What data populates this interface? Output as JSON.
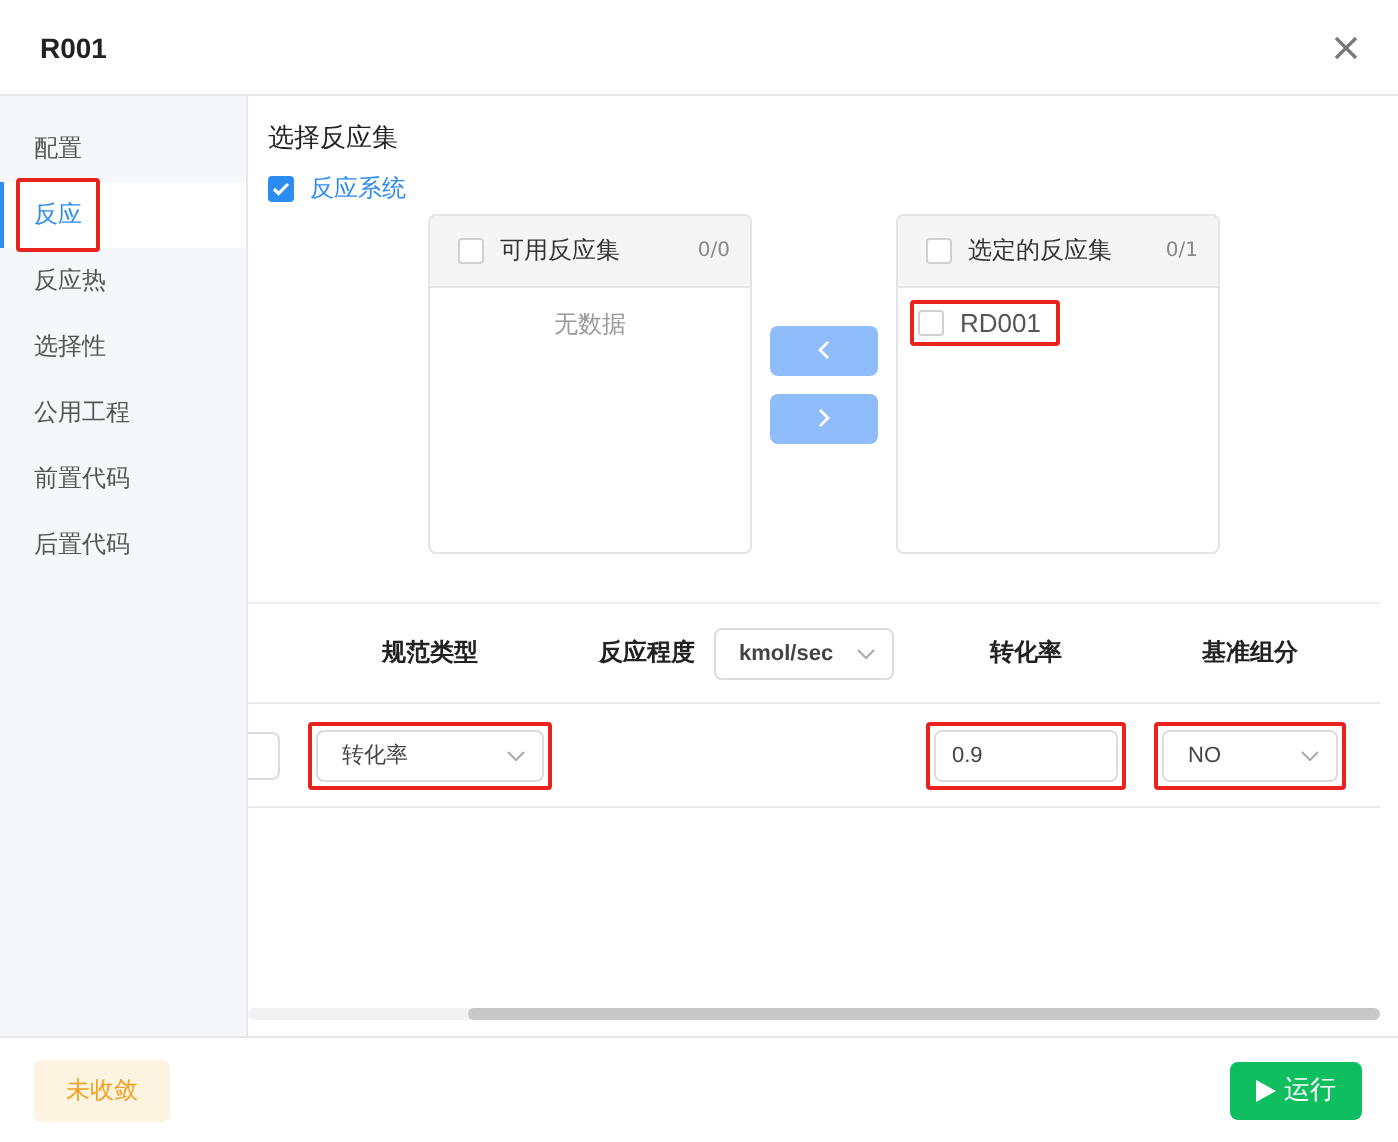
{
  "window": {
    "title": "R001"
  },
  "sidebar": {
    "items": [
      {
        "label": "配置",
        "selected": false,
        "highlighted": false
      },
      {
        "label": "反应",
        "selected": true,
        "highlighted": true
      },
      {
        "label": "反应热",
        "selected": false,
        "highlighted": false
      },
      {
        "label": "选择性",
        "selected": false,
        "highlighted": false
      },
      {
        "label": "公用工程",
        "selected": false,
        "highlighted": false
      },
      {
        "label": "前置代码",
        "selected": false,
        "highlighted": false
      },
      {
        "label": "后置代码",
        "selected": false,
        "highlighted": false
      }
    ]
  },
  "section_title": "选择反应集",
  "system_checkbox": {
    "label": "反应系统",
    "checked": true
  },
  "transfer": {
    "left": {
      "title": "可用反应集",
      "count": "0/0",
      "checked": false,
      "empty_text": "无数据"
    },
    "right": {
      "title": "选定的反应集",
      "count": "0/1",
      "checked": false,
      "items": [
        {
          "label": "RD001",
          "checked": false,
          "highlighted": true
        }
      ]
    }
  },
  "table": {
    "columns": [
      {
        "label": "规范类型"
      },
      {
        "label": "反应程度",
        "unit_select": "kmol/sec"
      },
      {
        "label": "转化率"
      },
      {
        "label": "基准组分"
      }
    ],
    "rows": [
      {
        "spec_type": {
          "value": "转化率",
          "highlighted": true
        },
        "conversion": {
          "value": "0.9",
          "highlighted": true
        },
        "base_component": {
          "value": "NO",
          "highlighted": true
        }
      }
    ]
  },
  "footer": {
    "status": "未收敛",
    "run_button": "运行"
  }
}
